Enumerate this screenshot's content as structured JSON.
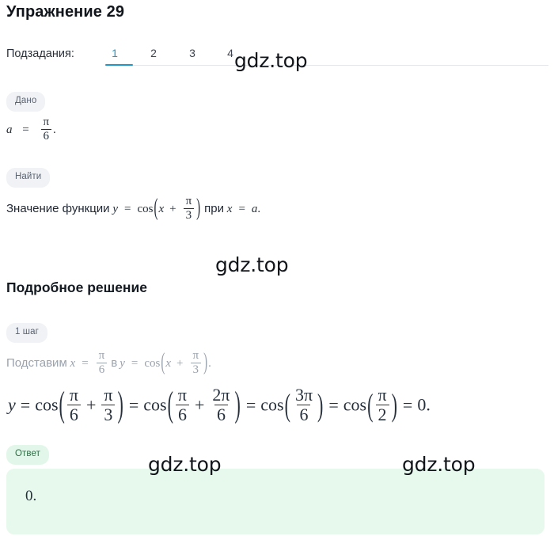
{
  "page": {
    "title": "Упражнение 29"
  },
  "subtasks": {
    "label": "Подзадания:",
    "items": [
      {
        "label": "1",
        "active": true
      },
      {
        "label": "2",
        "active": false
      },
      {
        "label": "3",
        "active": false
      },
      {
        "label": "4",
        "active": false
      }
    ],
    "active_color": "#2196c9"
  },
  "given": {
    "badge": "Дано",
    "formula": {
      "variable": "a",
      "equals": "=",
      "numerator": "π",
      "denominator": "6",
      "period": "."
    }
  },
  "find": {
    "badge": "Найти",
    "text_before": "Значение функции",
    "y": "y",
    "equals": "=",
    "cos": "cos",
    "paren_open": "(",
    "x": "x",
    "plus": "+",
    "numerator": "π",
    "denominator": "3",
    "paren_close": ")",
    "text_at": "при",
    "x2": "x",
    "equals2": "=",
    "a": "a",
    "period": "."
  },
  "solution": {
    "heading": "Подробное решение",
    "step": {
      "badge": "1 шаг",
      "text_before": "Подставим",
      "x": "x",
      "equals": "=",
      "numerator": "π",
      "denominator": "6",
      "text_in": "в",
      "y": "y",
      "equals2": "=",
      "cos": "cos",
      "paren_open": "(",
      "x2": "x",
      "plus": "+",
      "numerator2": "π",
      "denominator2": "3",
      "paren_close": ")",
      "period": "."
    },
    "chain": {
      "y": "y",
      "eq1": "=",
      "cos1": "cos",
      "t1_num1": "π",
      "t1_den1": "6",
      "t1_plus": "+",
      "t1_num2": "π",
      "t1_den2": "3",
      "eq2": "=",
      "cos2": "cos",
      "t2_num1": "π",
      "t2_den1": "6",
      "t2_plus": "+",
      "t2_num2": "2π",
      "t2_den2": "6",
      "eq3": "=",
      "cos3": "cos",
      "t3_num": "3π",
      "t3_den": "6",
      "eq4": "=",
      "cos4": "cos",
      "t4_num": "π",
      "t4_den": "2",
      "eq5": "=",
      "result": "0",
      "period": "."
    }
  },
  "answer": {
    "badge": "Ответ",
    "value": "0.",
    "background_color": "#e6f9ec",
    "badge_color": "#e2f7e9"
  },
  "watermarks": [
    {
      "text": "gdz.top"
    },
    {
      "text": "gdz.top"
    },
    {
      "text": "gdz.top"
    },
    {
      "text": "gdz.top"
    }
  ]
}
